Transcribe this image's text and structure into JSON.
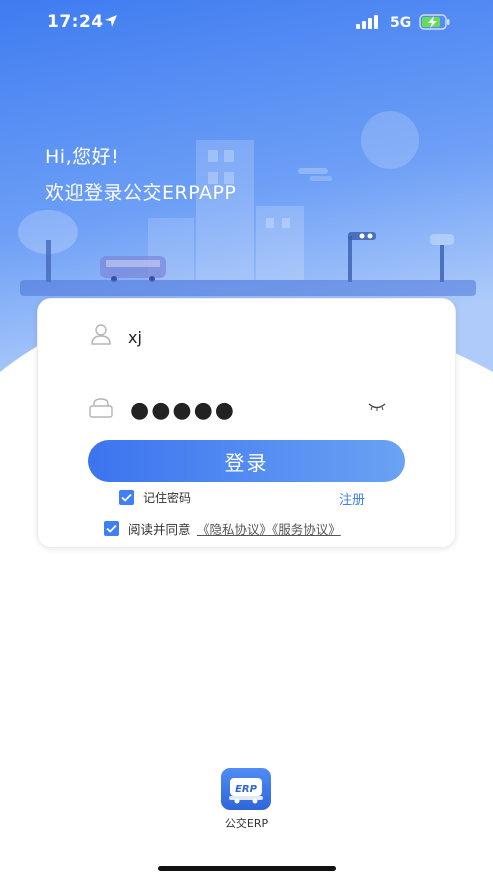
{
  "status_bar": {
    "time": "17:24",
    "network": "5G",
    "icons": [
      "location-arrow-icon",
      "signal-icon",
      "battery-charging-icon"
    ]
  },
  "header": {
    "greeting": "Hi,您好!",
    "welcome": "欢迎登录公交ERPAPP"
  },
  "login_form": {
    "username_value": "xj",
    "password_value": "●●●●●",
    "login_button": "登录",
    "remember_password": "记住密码",
    "remember_checked": true,
    "register_link": "注册",
    "agree_prefix": "阅读并同意",
    "agreement_links": "《隐私协议》《服务协议》",
    "agree_checked": true
  },
  "footer": {
    "app_logo_text": "ERP",
    "app_name": "公交ERP"
  },
  "colors": {
    "primary": "#3f7ef4",
    "hero_top": "#4a84f2",
    "hero_bottom": "#a9c9fb"
  }
}
